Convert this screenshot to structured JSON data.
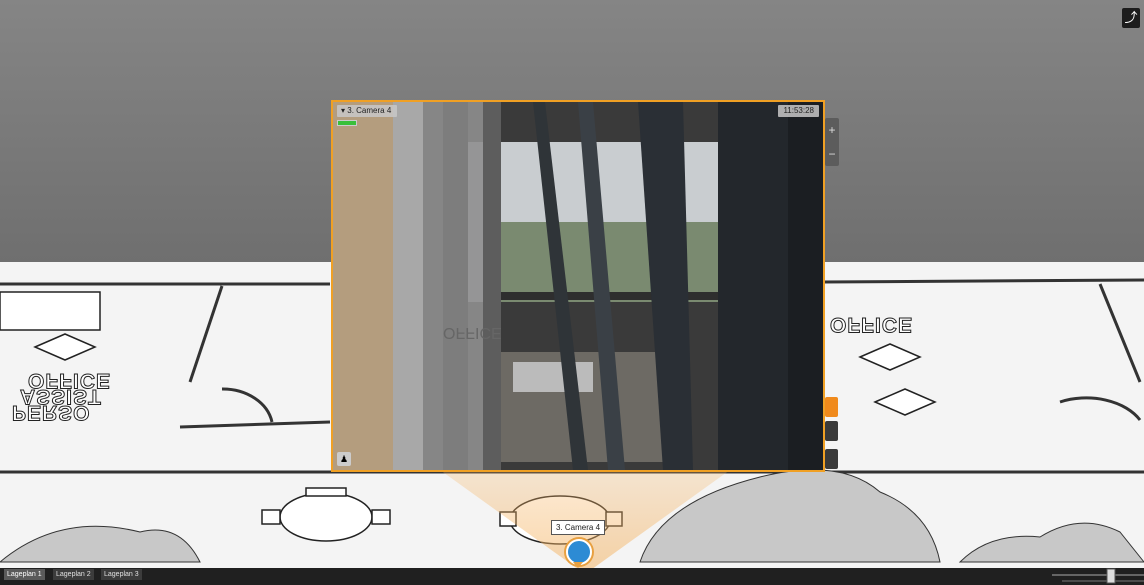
{
  "scene": {
    "sky_color": "#7a7a7a",
    "floor_color": "#f4f4f4"
  },
  "plan_labels": {
    "office_left": "OFFICE",
    "assist": "ASSIST",
    "perso": "PERSO",
    "office_right": "OFFICE",
    "office_video1": "OFFICE",
    "office_video2": "OFFICE"
  },
  "camera_viewer": {
    "title": "3. Camera 4",
    "time": "11:53:28",
    "border_color": "#f0a024"
  },
  "camera_marker": {
    "tag": "3. Camera 4",
    "icon": "video-camera-icon"
  },
  "zoom": {
    "plus": "+",
    "minus": "−"
  },
  "side_buttons": [
    {
      "icon": "alarm-icon",
      "color": "#f08a1c"
    },
    {
      "icon": "archive-icon",
      "color": "#1e74c8"
    },
    {
      "icon": "search-icon",
      "color": "#2a9a3a"
    }
  ],
  "exit_icon": "exit-icon",
  "tabs": [
    {
      "label": "Lageplan 1"
    },
    {
      "label": "Lageplan 2"
    },
    {
      "label": "Lageplan 3"
    }
  ]
}
